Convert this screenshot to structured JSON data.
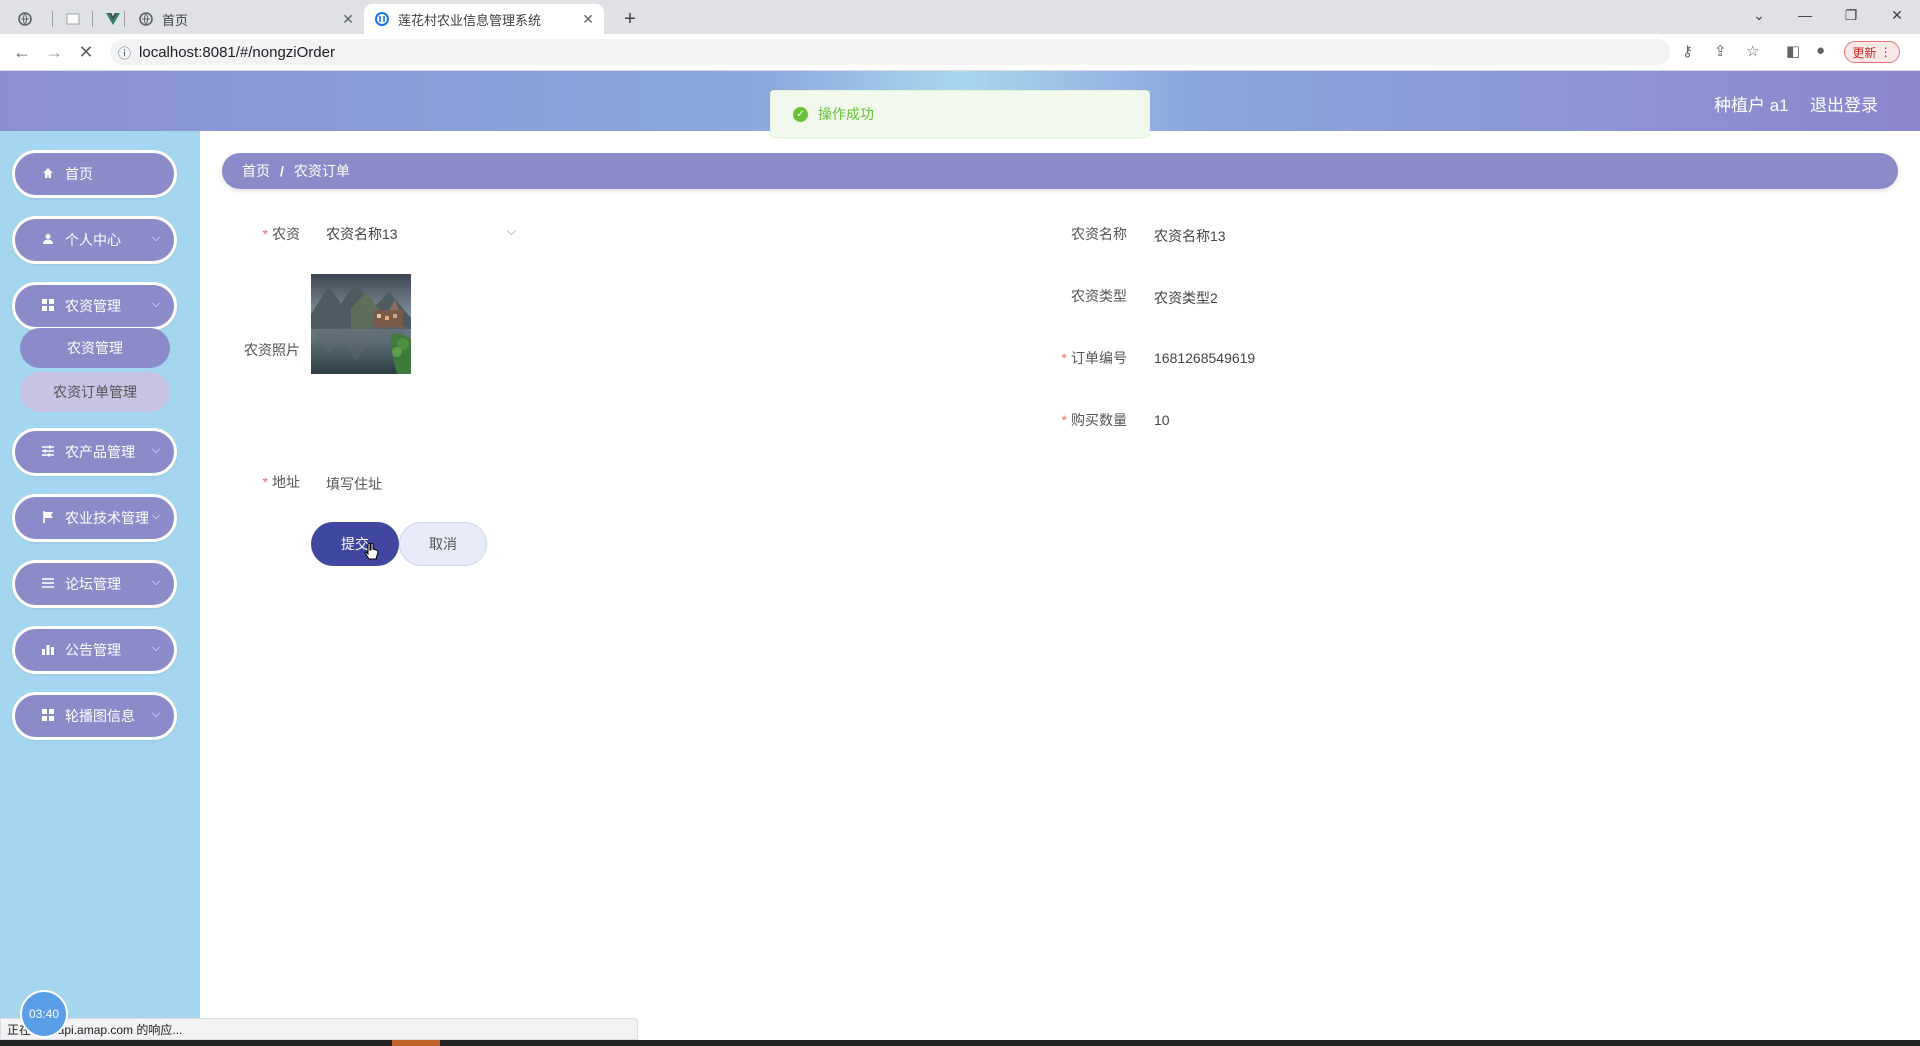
{
  "browser": {
    "tabs": [
      {
        "label": "",
        "icon": "globe-icon"
      },
      {
        "label": "",
        "icon": "blank-page-icon"
      },
      {
        "label": "",
        "icon": "vue-logo-icon"
      },
      {
        "label": "首页",
        "icon": "globe-icon"
      },
      {
        "label": "莲花村农业信息管理系统",
        "icon": "site-logo-icon",
        "active": true
      }
    ],
    "url": "localhost:8081/#/nongziOrder",
    "update_label": "更新"
  },
  "header": {
    "user_label": "种植户 a1",
    "logout_label": "退出登录"
  },
  "toast": {
    "message": "操作成功",
    "type": "success",
    "color": "#67c23a"
  },
  "sidebar": {
    "items": [
      {
        "label": "首页",
        "icon": "home-icon",
        "expandable": false
      },
      {
        "label": "个人中心",
        "icon": "user-icon",
        "expandable": true
      },
      {
        "label": "农资管理",
        "icon": "grid-icon",
        "expandable": true,
        "expanded": true,
        "children": [
          {
            "label": "农资管理",
            "selected": true
          },
          {
            "label": "农资订单管理",
            "selected": false
          }
        ]
      },
      {
        "label": "农产品管理",
        "icon": "sliders-icon",
        "expandable": true
      },
      {
        "label": "农业技术管理",
        "icon": "flag-icon",
        "expandable": true
      },
      {
        "label": "论坛管理",
        "icon": "list-icon",
        "expandable": true
      },
      {
        "label": "公告管理",
        "icon": "bar-chart-icon",
        "expandable": true
      },
      {
        "label": "轮播图信息",
        "icon": "grid-icon",
        "expandable": true
      }
    ]
  },
  "breadcrumb": {
    "home": "首页",
    "separator": "/",
    "current": "农资订单"
  },
  "form": {
    "nongzi": {
      "label": "农资",
      "required": true,
      "value": "农资名称13"
    },
    "photo": {
      "label": "农资照片"
    },
    "address": {
      "label": "地址",
      "required": true,
      "value": "填写住址"
    },
    "name": {
      "label": "农资名称",
      "value": "农资名称13"
    },
    "type": {
      "label": "农资类型",
      "value": "农资类型2"
    },
    "order_no": {
      "label": "订单编号",
      "required": true,
      "value": "1681268549619"
    },
    "quantity": {
      "label": "购买数量",
      "required": true,
      "value": "10"
    },
    "submit_label": "提交",
    "cancel_label": "取消"
  },
  "clock": "03:40",
  "status_text": "正在 ...ebapi.amap.com 的响应...",
  "colors": {
    "sidebar_bg": "#a5d6ef",
    "menu_bg": "#8c8bc9",
    "submit_bg": "#4047a0"
  }
}
